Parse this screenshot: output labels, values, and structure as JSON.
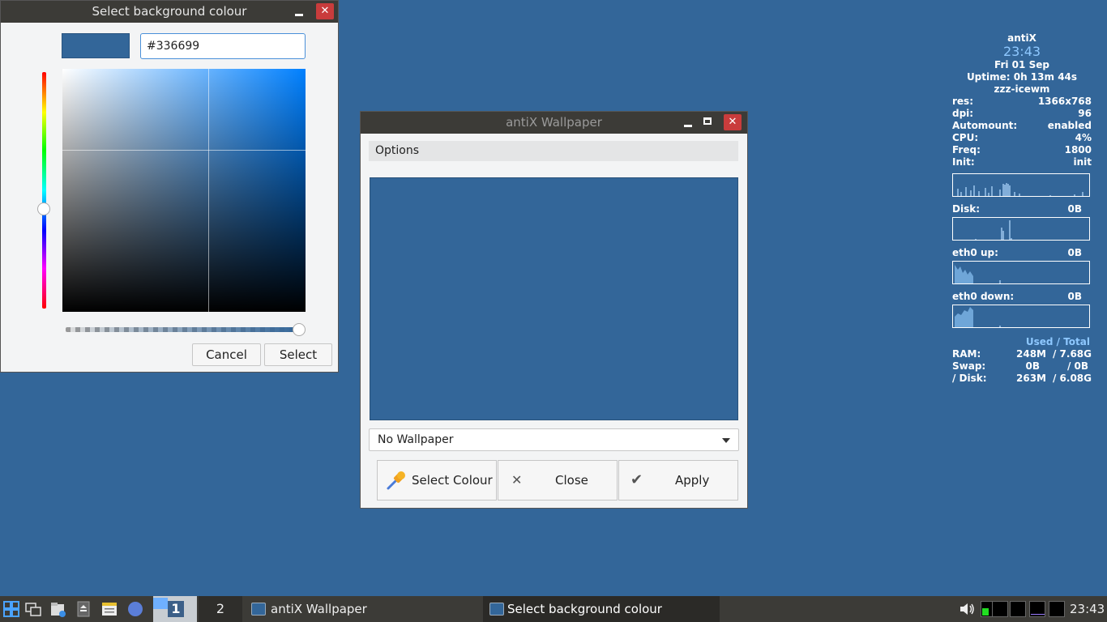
{
  "colour_dialog": {
    "title": "Select background colour",
    "hex_value": "#336699",
    "cancel_label": "Cancel",
    "select_label": "Select",
    "current_colour": "#336699"
  },
  "wallpaper_window": {
    "title": "antiX Wallpaper",
    "options_label": "Options",
    "wallpaper_select": "No Wallpaper",
    "select_colour_label": "Select Colour",
    "close_label": "Close",
    "apply_label": "Apply"
  },
  "conky": {
    "hostname": "antiX",
    "time": "23:43",
    "date": "Fri 01 Sep",
    "uptime": "Uptime: 0h 13m 44s",
    "wm": "zzz-icewm",
    "rows": [
      {
        "label": "res:",
        "value": "1366x768"
      },
      {
        "label": "dpi:",
        "value": "96"
      },
      {
        "label": "Automount:",
        "value": "enabled"
      },
      {
        "label": "CPU:",
        "value": "4%"
      },
      {
        "label": "Freq:",
        "value": "1800"
      },
      {
        "label": "Init:",
        "value": "init"
      }
    ],
    "disk": {
      "label": "Disk:",
      "value": "0B"
    },
    "eth_up": {
      "label": "eth0 up:",
      "value": "0B"
    },
    "eth_down": {
      "label": "eth0 down:",
      "value": "0B"
    },
    "usage_header": "Used / Total",
    "usage": [
      {
        "label": "RAM:",
        "used": "248M",
        "total": "/ 7.68G"
      },
      {
        "label": "Swap:",
        "used": "0B",
        "total": "/ 0B"
      },
      {
        "label": "/ Disk:",
        "used": "263M",
        "total": "/ 6.08G"
      }
    ]
  },
  "taskbar": {
    "workspace_1": "1",
    "workspace_2": "2",
    "task_1": "antiX Wallpaper",
    "task_2": "Select background colour",
    "clock": "23:43"
  }
}
